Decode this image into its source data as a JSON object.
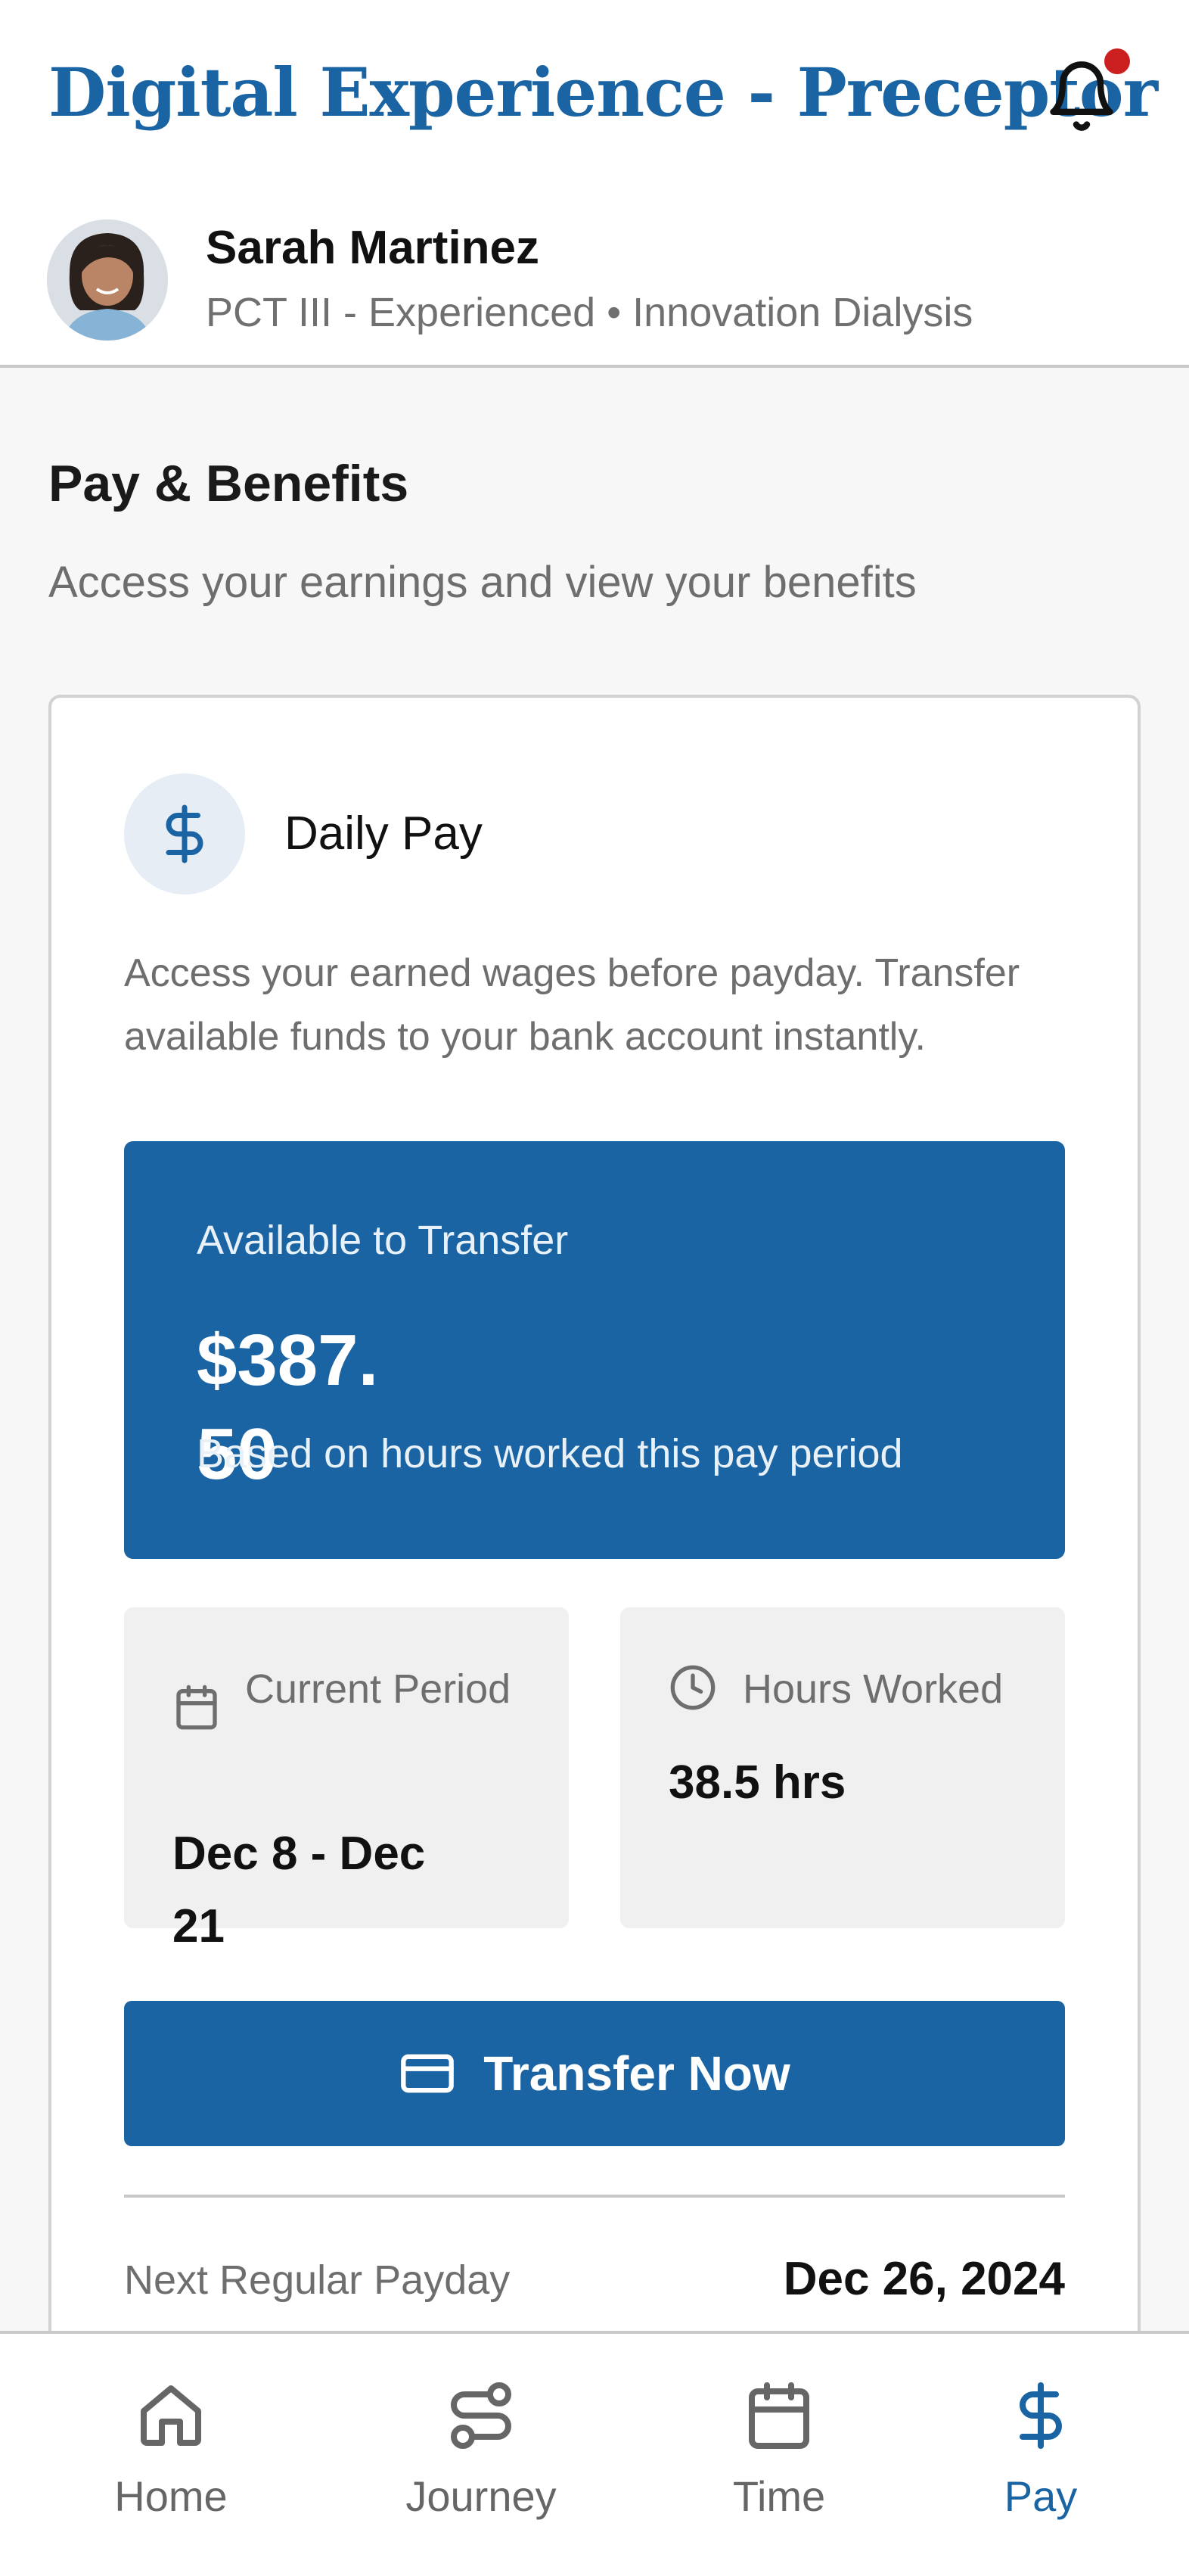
{
  "header": {
    "app_title": "Digital Experience - Preceptor",
    "notification_icon": "bell-icon",
    "has_notification": true,
    "notification_color": "#cc1f1f"
  },
  "user": {
    "name": "Sarah Martinez",
    "meta": "PCT III - Experienced • Innovation Dialysis"
  },
  "page": {
    "title": "Pay & Benefits",
    "subtitle": "Access your earnings and view your benefits"
  },
  "daily_pay": {
    "icon": "dollar-icon",
    "title": "Daily Pay",
    "description": "Access your earned wages before payday. Transfer available funds to your bank account instantly.",
    "available_label": "Available to Transfer",
    "available_amount": "$387.50",
    "available_note": "Based on hours worked this pay period",
    "current_period_label": "Current Period",
    "current_period_value": "Dec 8 - Dec 21",
    "hours_label": "Hours Worked",
    "hours_value": "38.5 hrs",
    "transfer_button": "Transfer Now",
    "next_payday_label": "Next Regular Payday",
    "next_payday_value": "Dec 26, 2024"
  },
  "nav": {
    "items": [
      {
        "label": "Home",
        "icon": "home-icon"
      },
      {
        "label": "Journey",
        "icon": "route-icon"
      },
      {
        "label": "Time",
        "icon": "calendar-icon"
      },
      {
        "label": "Pay",
        "icon": "dollar-icon",
        "active": true
      }
    ]
  },
  "colors": {
    "brand": "#1a64a3",
    "text_muted": "#6e6e6e",
    "surface_muted": "#f0f0f0"
  }
}
